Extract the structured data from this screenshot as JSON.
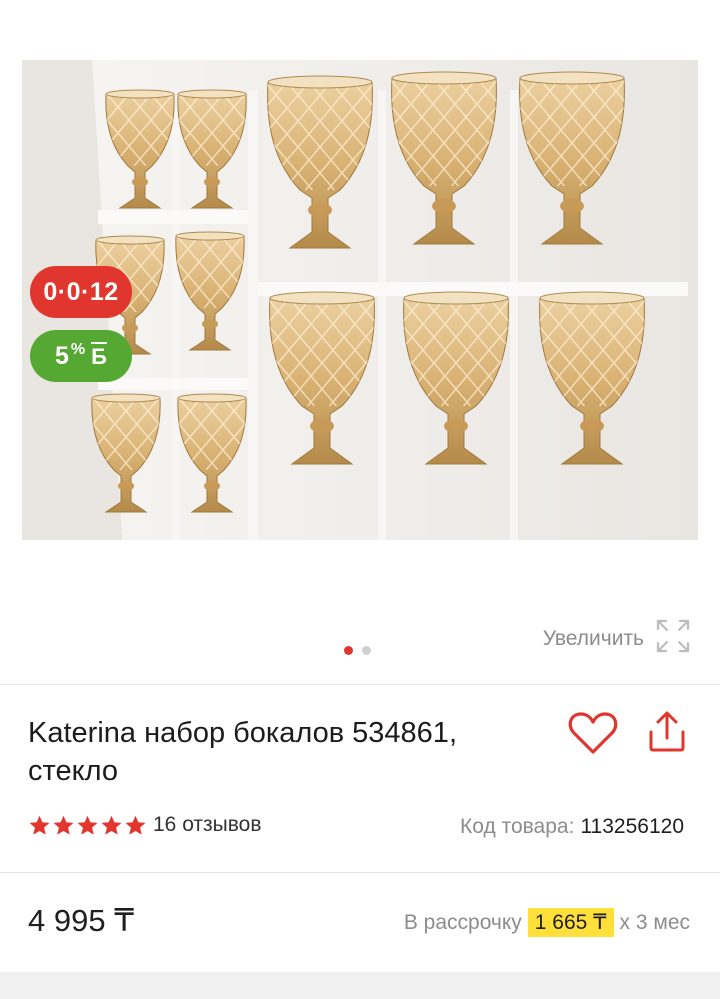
{
  "gallery": {
    "photo_alt": "",
    "badges": {
      "installment": "0·0·12",
      "bonus_value": "5",
      "bonus_percent": "%",
      "bonus_currency": "Б"
    },
    "zoom_label": "Увеличить",
    "dots_total": 2,
    "active_dot": 1
  },
  "product": {
    "title": "Katerina набор бокалов 534861, стекло",
    "rating": 5,
    "reviews_label": "16 отзывов",
    "sku_label": "Код товара:",
    "sku_value": "113256120"
  },
  "pricing": {
    "price": "4 995 ₸",
    "installment_label": "В рассрочку",
    "installment_amount": "1 665 ₸",
    "installment_term": "х 3 мес"
  },
  "colors": {
    "accent_red": "#e1362e",
    "bonus_green": "#55a832",
    "highlight_yellow": "#ffe03b"
  },
  "icons": [
    "heart-icon",
    "share-icon",
    "expand-icon",
    "star-icon"
  ]
}
